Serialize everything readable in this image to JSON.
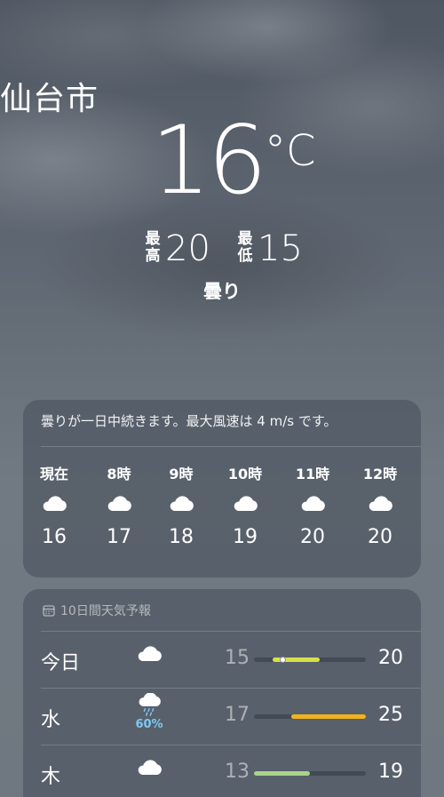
{
  "current": {
    "city": "仙台市",
    "temperature": "16",
    "unit": "°C",
    "high_label": "最高",
    "high": "20",
    "low_label": "最低",
    "low": "15",
    "condition": "曇り"
  },
  "hourly": {
    "summary": "曇りが一日中続きます。最大風速は 4 m/s です。",
    "items": [
      {
        "time": "現在",
        "icon": "cloud-icon",
        "temp": "16"
      },
      {
        "time": "8時",
        "icon": "cloud-icon",
        "temp": "17"
      },
      {
        "time": "9時",
        "icon": "cloud-icon",
        "temp": "18"
      },
      {
        "time": "10時",
        "icon": "cloud-icon",
        "temp": "19"
      },
      {
        "time": "11時",
        "icon": "cloud-icon",
        "temp": "20"
      },
      {
        "time": "12時",
        "icon": "cloud-icon",
        "temp": "20"
      }
    ]
  },
  "daily": {
    "header": "10日間天気予報",
    "header_icon": "calendar-icon",
    "range_min": 13,
    "range_max": 25,
    "days": [
      {
        "day": "今日",
        "icon": "cloud-icon",
        "precip": "",
        "low": "15",
        "high": "20",
        "current": 16,
        "color": "#d7e04a"
      },
      {
        "day": "水",
        "icon": "rain-cloud-icon",
        "precip": "60%",
        "low": "17",
        "high": "25",
        "color": "#f2b21b"
      },
      {
        "day": "木",
        "icon": "cloud-icon",
        "precip": "",
        "low": "13",
        "high": "19",
        "color": "#a8d48a"
      }
    ]
  }
}
